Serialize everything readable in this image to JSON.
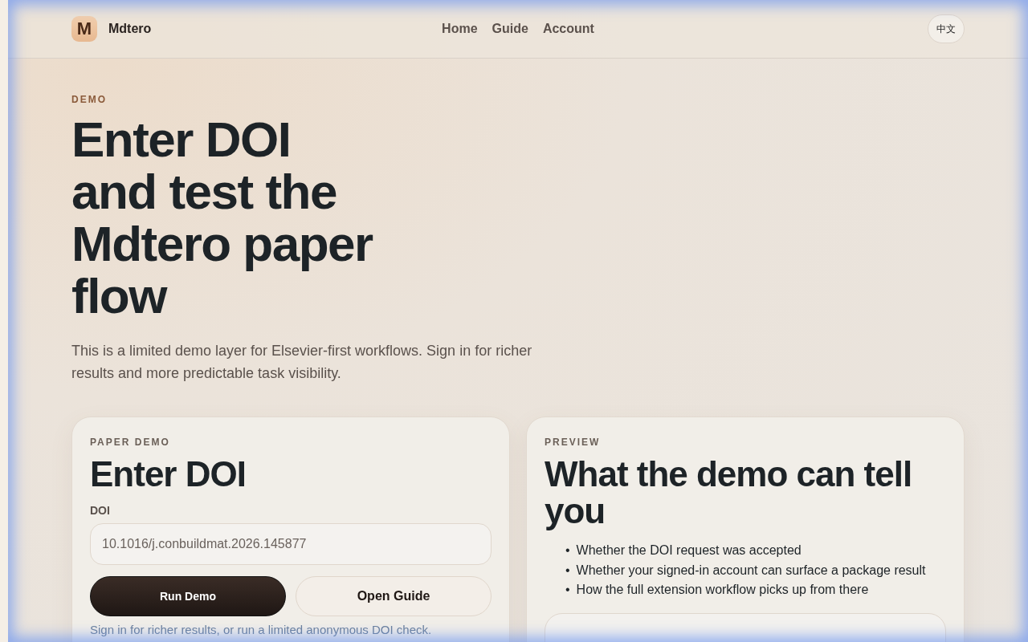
{
  "header": {
    "logo_letter": "M",
    "brand": "Mdtero",
    "nav": [
      "Home",
      "Guide",
      "Account"
    ],
    "language_button": "中文"
  },
  "hero": {
    "eyebrow": "DEMO",
    "title_lines": [
      "Enter DOI",
      "and test the",
      "Mdtero paper",
      "flow"
    ],
    "intro": "This is a limited demo layer for Elsevier-first workflows. Sign in for richer results and more predictable task visibility."
  },
  "demo_card": {
    "eyebrow": "PAPER DEMO",
    "title": "Enter DOI",
    "field_label": "DOI",
    "field_value": "10.1016/j.conbuildmat.2026.145877",
    "buttons": [
      {
        "label": "Run Demo",
        "kind": "primary"
      },
      {
        "label": "Open Guide",
        "kind": "secondary"
      }
    ],
    "note": "Sign in for richer results, or run a limited anonymous DOI check."
  },
  "preview_card": {
    "eyebrow": "PREVIEW",
    "bullet_marker": "•",
    "title": "What the demo can tell you",
    "bullets": [
      "Whether the DOI request was accepted",
      "Whether your signed-in account can surface a package result",
      "How the full extension workflow picks up from there"
    ]
  }
}
